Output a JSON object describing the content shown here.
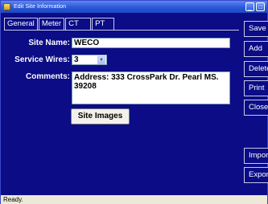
{
  "window": {
    "title": "Edit Site Information",
    "controls": [
      "_",
      "□"
    ]
  },
  "tabs": [
    {
      "label": "General",
      "active": true
    },
    {
      "label": "Meter",
      "active": false
    },
    {
      "label": "CT",
      "active": false
    },
    {
      "label": "PT",
      "active": false
    }
  ],
  "form": {
    "site_name_label": "Site Name:",
    "site_name_value": "WECO",
    "service_wires_label": "Service Wires:",
    "service_wires_value": "3",
    "comments_label": "Comments:",
    "comments_value": "Address: 333 CrossPark Dr. Pearl MS. 39208",
    "site_images_label": "Site Images"
  },
  "side_buttons": {
    "save": "Save",
    "add": "Add",
    "delete": "Delete",
    "print": "Print",
    "close": "Close",
    "import": "Import",
    "export": "Export"
  },
  "status": "Ready."
}
